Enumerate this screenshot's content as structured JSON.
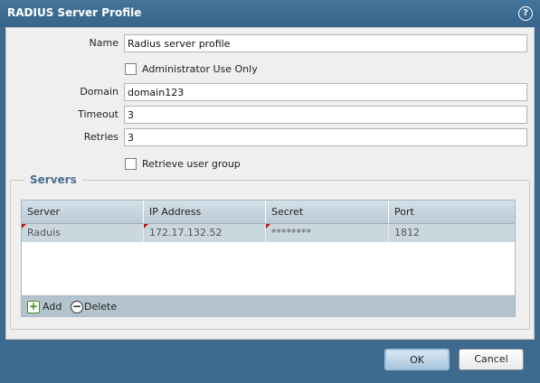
{
  "dialog": {
    "title": "RADIUS Server Profile",
    "help_icon": "help-circle-icon"
  },
  "form": {
    "name_label": "Name",
    "name_value": "Radius server profile",
    "admin_use_label": "Administrator Use Only",
    "admin_use_checked": false,
    "domain_label": "Domain",
    "domain_value": "domain123",
    "timeout_label": "Timeout",
    "timeout_value": "3",
    "retries_label": "Retries",
    "retries_value": "3",
    "retrieve_group_label": "Retrieve user group",
    "retrieve_group_checked": false
  },
  "servers": {
    "legend": "Servers",
    "columns": [
      "Server",
      "IP Address",
      "Secret",
      "Port"
    ],
    "rows": [
      {
        "server": "Raduis",
        "ip": "172.17.132.52",
        "secret": "********",
        "port": "1812"
      }
    ],
    "add_label": "Add",
    "delete_label": "Delete",
    "add_icon": "add-icon",
    "delete_icon": "minus-circle-icon"
  },
  "footer": {
    "ok_label": "OK",
    "cancel_label": "Cancel"
  },
  "colors": {
    "titlebar": "#3d6a8e",
    "panel": "#efefef",
    "grid_header": "#c6d3dc",
    "selected_row": "#cbd7df",
    "accent_legend": "#4a6f8e"
  }
}
